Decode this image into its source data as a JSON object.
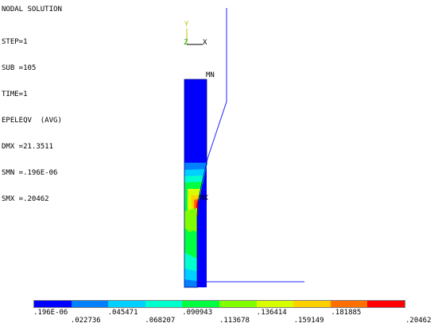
{
  "header": {
    "title": "NODAL SOLUTION",
    "step": "STEP=1",
    "sub": "SUB =105",
    "time": "TIME=1",
    "quantity": "EPELEQV  (AVG)",
    "dmx": "DMX =21.3511",
    "smn": "SMN =.196E-06",
    "smx": "SMX =.20462"
  },
  "triad": {
    "y": "Y",
    "z": "Z",
    "x": "X"
  },
  "markers": {
    "mn": "MN",
    "mx": "MX"
  },
  "legend": {
    "colors": [
      "#0000ff",
      "#0080ff",
      "#00d0ff",
      "#00ffcc",
      "#00ff40",
      "#80ff00",
      "#d8ff00",
      "#ffd000",
      "#ff7000",
      "#ff0000"
    ],
    "top_labels": [
      ".196E-06",
      ".045471",
      ".090943",
      ".136414",
      ".181885"
    ],
    "bottom_labels": [
      ".022736",
      ".068207",
      ".113678",
      ".159149",
      ".20462"
    ]
  },
  "colors": {
    "edge": "#0000c0",
    "background": "#ffffff"
  }
}
